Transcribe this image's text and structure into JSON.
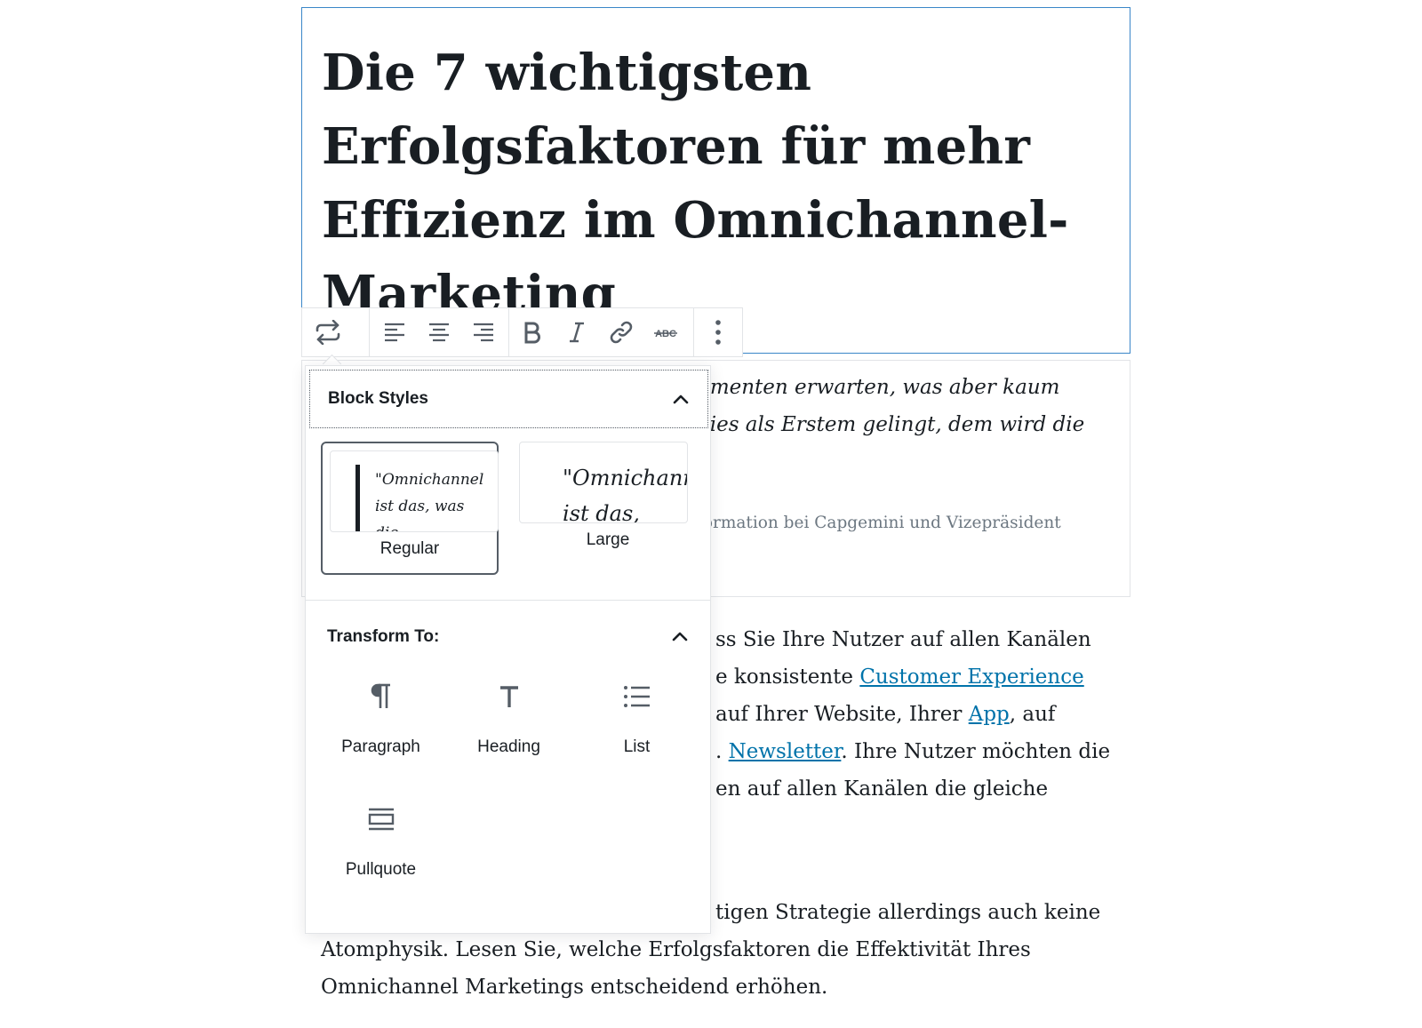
{
  "title_block": {
    "title": "Die 7 wichtigsten Erfolgsfaktoren für mehr Effizienz im Omnichannel-Marketing"
  },
  "quote_block": {
    "line1": "umenten erwarten, was aber kaum",
    "line2": "dies als Erstem gelingt, dem wird die",
    "citation": "formation bei Capgemini und Vizepräsident"
  },
  "paragraph1": {
    "line1": "ss Sie Ihre Nutzer auf allen Kanälen",
    "line2_text": "e konsistente ",
    "line2_link": "Customer Experience",
    "line3_text": "auf Ihrer Website, Ihrer ",
    "line3_link": "App",
    "line3_after": ", auf",
    "line4_link": "Newsletter",
    "line4_before": ". ",
    "line4_after": ". Ihre Nutzer möchten die",
    "line5": "en auf allen Kanälen die gleiche"
  },
  "paragraph2": {
    "line1": "tigen Strategie allerdings auch keine",
    "line2": "Atomphysik. Lesen Sie, welche Erfolgsfaktoren die Effektivität Ihres",
    "line3": "Omnichannel Marketings entscheidend erhöhen."
  },
  "toolbar": {
    "buttons": [
      {
        "name": "transform",
        "icon": "transform-icon"
      },
      {
        "name": "align-left",
        "icon": "align-left-icon"
      },
      {
        "name": "align-center",
        "icon": "align-center-icon"
      },
      {
        "name": "align-right",
        "icon": "align-right-icon"
      },
      {
        "name": "bold",
        "icon": "bold-icon"
      },
      {
        "name": "italic",
        "icon": "italic-icon"
      },
      {
        "name": "link",
        "icon": "link-icon"
      },
      {
        "name": "strikethrough",
        "icon": "strikethrough-icon",
        "label": "ABC"
      },
      {
        "name": "more-options",
        "icon": "more-vertical-icon"
      }
    ]
  },
  "popover": {
    "block_styles": {
      "title": "Block Styles",
      "options": [
        {
          "label": "Regular",
          "preview": "\"Omnichannel\nist das, was\ndie",
          "selected": true
        },
        {
          "label": "Large",
          "preview": "\"Omnichannel\nist das,",
          "selected": false
        }
      ]
    },
    "transform": {
      "title": "Transform To:",
      "items": [
        {
          "label": "Paragraph",
          "icon": "paragraph-icon"
        },
        {
          "label": "Heading",
          "icon": "heading-icon"
        },
        {
          "label": "List",
          "icon": "list-icon"
        },
        {
          "label": "Pullquote",
          "icon": "pullquote-icon"
        }
      ]
    }
  },
  "colors": {
    "accent_border": "#3a86c8",
    "link": "#0073aa",
    "text": "#191e23",
    "icon": "#555d66",
    "muted": "#6c7781"
  }
}
